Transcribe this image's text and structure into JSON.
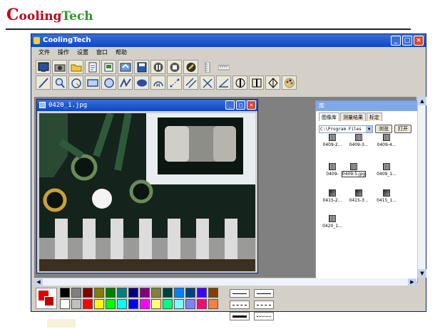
{
  "brand": {
    "first": "C",
    "mid1": "ooling",
    "second": "T",
    "mid2": "ech"
  },
  "window": {
    "title": "CoolingTech"
  },
  "menu": [
    "文件",
    "操作",
    "设置",
    "窗口",
    "帮助"
  ],
  "toolbar1_icons": [
    "monitor-icon",
    "camera-icon",
    "open-folder-icon",
    "document-icon",
    "export-icon",
    "sync-icon",
    "save-icon",
    "pause-icon",
    "stop-icon",
    "settings-icon",
    "ruler-vertical-icon",
    "ruler-horizontal-icon"
  ],
  "toolbar2_icons": [
    "line-tool-icon",
    "magnifier-icon",
    "arc-tool-icon",
    "rectangle-tool-icon",
    "circle-tool-icon",
    "polyline-tool-icon",
    "ellipse-tool-icon",
    "half-circle-icon",
    "point-distance-icon",
    "parallel-line-icon",
    "angle-icon",
    "angle-measure-icon",
    "vertical-measure-icon",
    "horizontal-measure-icon",
    "diamond-icon",
    "palette-icon"
  ],
  "image_window": {
    "title": "0420_1.jpg"
  },
  "library": {
    "title": "库",
    "tabs": [
      "图像库",
      "测量结果",
      "标定"
    ],
    "path": "C:\\Program Files",
    "browse_label": "浏览",
    "open_label": "打开",
    "thumbs": [
      {
        "label": "0409-2...",
        "kind": "striped"
      },
      {
        "label": "0409-3...",
        "kind": "striped"
      },
      {
        "label": "0409-4...",
        "kind": "striped"
      },
      {
        "label": "0409-",
        "kind": "striped"
      },
      {
        "label": "0409-5.jpg",
        "kind": "striped",
        "editing": true
      },
      {
        "label": "0409_1...",
        "kind": "striped"
      },
      {
        "label": "0415-2...",
        "kind": "dark"
      },
      {
        "label": "0415-3...",
        "kind": "dark"
      },
      {
        "label": "0415_1...",
        "kind": "dark"
      },
      {
        "label": "0420_1...",
        "kind": "striped"
      }
    ]
  },
  "colors": {
    "current_fg": "#e00000",
    "current_bg": "#c00000",
    "swatches_row1": [
      "#000000",
      "#808080",
      "#800000",
      "#808000",
      "#008000",
      "#008080",
      "#000080",
      "#800080",
      "#808040",
      "#004040",
      "#0080ff",
      "#004080",
      "#4000ff",
      "#804000"
    ],
    "swatches_row2": [
      "#ffffff",
      "#c0c0c0",
      "#ff0000",
      "#ffff00",
      "#00ff00",
      "#00ffff",
      "#0000ff",
      "#ff00ff",
      "#ffff80",
      "#00ff80",
      "#80ffff",
      "#8080ff",
      "#ff0080",
      "#ff8040"
    ]
  },
  "line_styles": [
    "thin-solid",
    "thin-solid-2",
    "dashed",
    "dashed-2",
    "thick-solid",
    "dotted"
  ]
}
